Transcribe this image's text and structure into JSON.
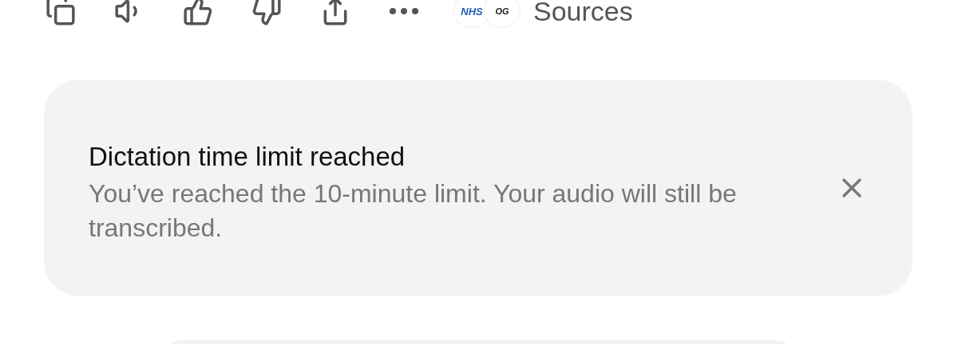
{
  "actions": {
    "sources": {
      "logos": [
        {
          "text": "NHS",
          "color": "#1f5fb4"
        },
        {
          "text": "OG",
          "color": "#222222"
        }
      ],
      "label": "Sources"
    }
  },
  "notice": {
    "title": "Dictation time limit reached",
    "message": "You’ve reached the 10-minute limit. Your audio will still be transcribed."
  }
}
